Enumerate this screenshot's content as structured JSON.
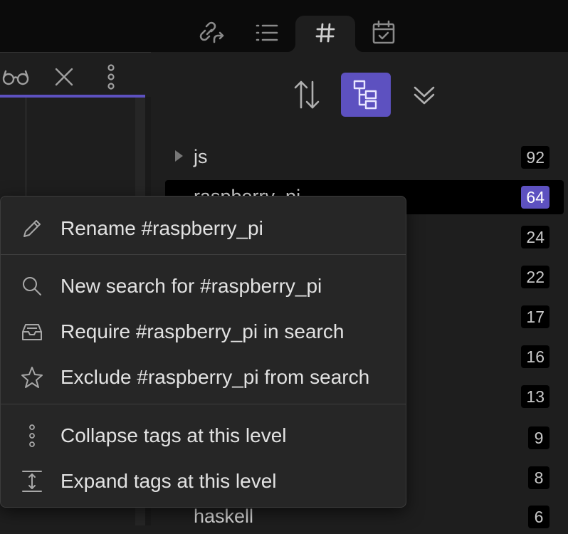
{
  "top_tabs": [
    {
      "icon": "backlink-icon"
    },
    {
      "icon": "list-icon"
    },
    {
      "icon": "hashtag-icon",
      "label": "#",
      "active": true
    },
    {
      "icon": "calendar-icon"
    }
  ],
  "left_header": {
    "icons": [
      "glasses-icon",
      "close-icon",
      "more-vertical-icon"
    ]
  },
  "toolbar": [
    {
      "icon": "sort-icon",
      "active": false
    },
    {
      "icon": "tree-icon",
      "active": true
    },
    {
      "icon": "collapse-all-icon",
      "active": false
    }
  ],
  "tags": [
    {
      "name": "js",
      "count": "92",
      "collapsed": true
    },
    {
      "name": "raspberry_pi",
      "count": "64",
      "selected": true
    },
    {
      "name": "",
      "count": "24"
    },
    {
      "name": "",
      "count": "22"
    },
    {
      "name": "",
      "count": "17"
    },
    {
      "name": "",
      "count": "16"
    },
    {
      "name": "",
      "count": "13"
    },
    {
      "name": "",
      "count": "9"
    },
    {
      "name": "",
      "count": "8"
    },
    {
      "name": "haskell",
      "count": "6"
    }
  ],
  "context_menu": {
    "items": [
      {
        "label": "Rename #raspberry_pi",
        "icon": "pencil-icon"
      },
      {
        "label": "New search for #raspberry_pi",
        "icon": "search-icon"
      },
      {
        "label": "Require #raspberry_pi in search",
        "icon": "inbox-icon"
      },
      {
        "label": "Exclude #raspberry_pi from search",
        "icon": "star-icon"
      },
      {
        "label": "Collapse tags at this level",
        "icon": "dots-vertical-icon"
      },
      {
        "label": "Expand tags at this level",
        "icon": "expand-vertical-icon"
      }
    ]
  },
  "colors": {
    "accent": "#5d51c0",
    "background": "#1e1e1e",
    "topbar": "#0b0b0b"
  }
}
